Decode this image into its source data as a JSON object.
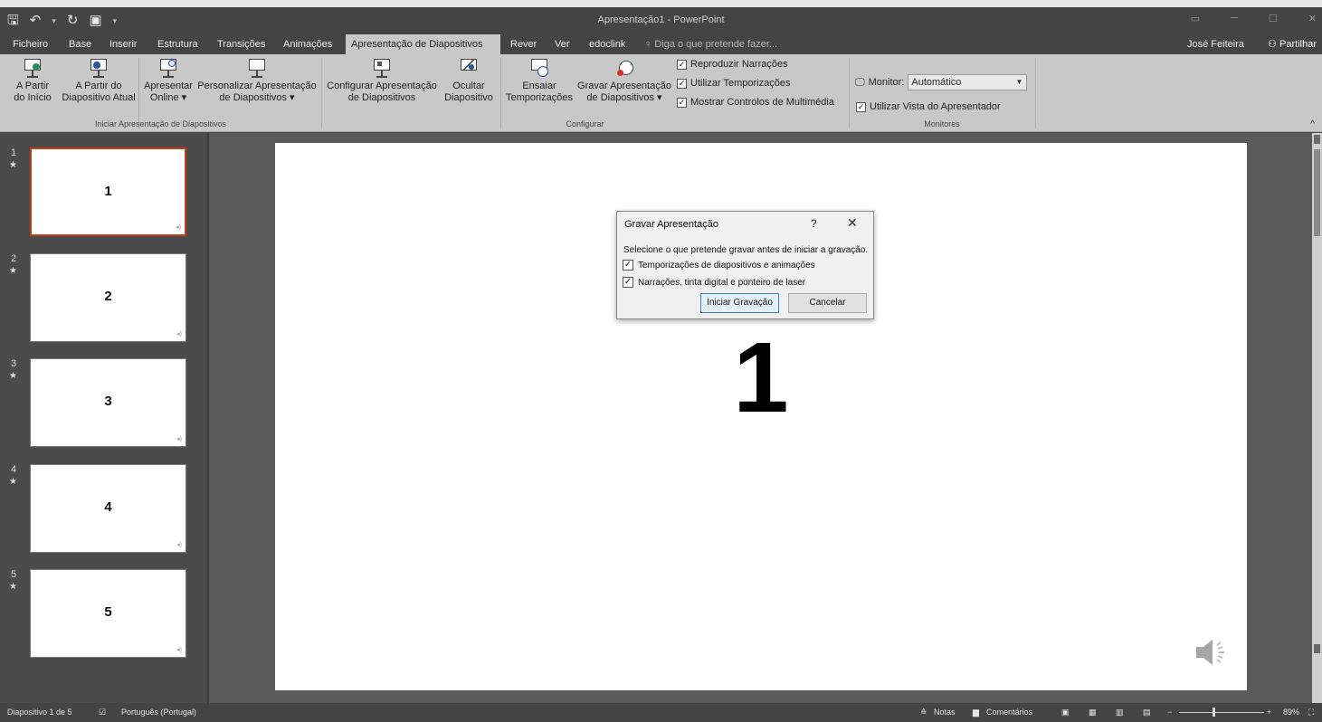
{
  "window": {
    "title": "Apresentação1 - PowerPoint"
  },
  "qat": {
    "save_icon": "save-icon",
    "undo_icon": "undo-icon",
    "redo_icon": "redo-icon",
    "present_icon": "start-from-beginning-icon",
    "customize_icon": "customize-qat-icon"
  },
  "tabs": [
    "Ficheiro",
    "Base",
    "Inserir",
    "Estrutura",
    "Transições",
    "Animações",
    "Apresentação de Diapositivos",
    "Rever",
    "Ver",
    "edoclink"
  ],
  "tell_me": "Diga o que pretende fazer...",
  "user": "José Feiteira",
  "share": "Partilhar",
  "ribbon": {
    "from_start": [
      "A Partir",
      "do Início"
    ],
    "from_current": [
      "A Partir do",
      "Diapositivo Atual"
    ],
    "present_online": [
      "Apresentar",
      "Online ▾"
    ],
    "custom_show": [
      "Personalizar Apresentação",
      "de Diapositivos ▾"
    ],
    "group_start": "Iniciar Apresentação de Diapositivos",
    "setup_show": [
      "Configurar Apresentação",
      "de Diapositivos"
    ],
    "hide_slide": [
      "Ocultar",
      "Diapositivo"
    ],
    "rehearse": [
      "Ensaiar",
      "Temporizações"
    ],
    "record": [
      "Gravar Apresentação",
      "de Diapositivos ▾"
    ],
    "play_narrations": "Reproduzir Narrações",
    "use_timings": "Utilizar Temporizações",
    "show_media_controls": "Mostrar Controlos de Multimédia",
    "group_setup": "Configurar",
    "monitor_label": "Monitor:",
    "monitor_value": "Automático",
    "presenter_view": "Utilizar Vista do Apresentador",
    "group_monitors": "Monitores"
  },
  "slides": [
    {
      "num": "1",
      "title": "1",
      "selected": true
    },
    {
      "num": "2",
      "title": "2",
      "selected": false
    },
    {
      "num": "3",
      "title": "3",
      "selected": false
    },
    {
      "num": "4",
      "title": "4",
      "selected": false
    },
    {
      "num": "5",
      "title": "5",
      "selected": false
    }
  ],
  "current_slide": {
    "title": "1"
  },
  "dialog": {
    "title": "Gravar Apresentação",
    "help": "?",
    "close": "✕",
    "prompt": "Selecione o que pretende gravar antes de iniciar a gravação.",
    "option_timings": "Temporizações de diapositivos e animações",
    "option_narrations": "Narrações, tinta digital e ponteiro de laser",
    "start_button": "Iniciar Gravação",
    "cancel_button": "Cancelar"
  },
  "status": {
    "slide_info": "Diapositivo 1 de 5",
    "language": "Português (Portugal)",
    "notes": "Notas",
    "comments": "Comentários",
    "zoom": "89%"
  },
  "colors": {
    "selected_thumb_border": "#c43e1c",
    "chrome_dark": "#444444",
    "ribbon": "#c8c8c8"
  }
}
